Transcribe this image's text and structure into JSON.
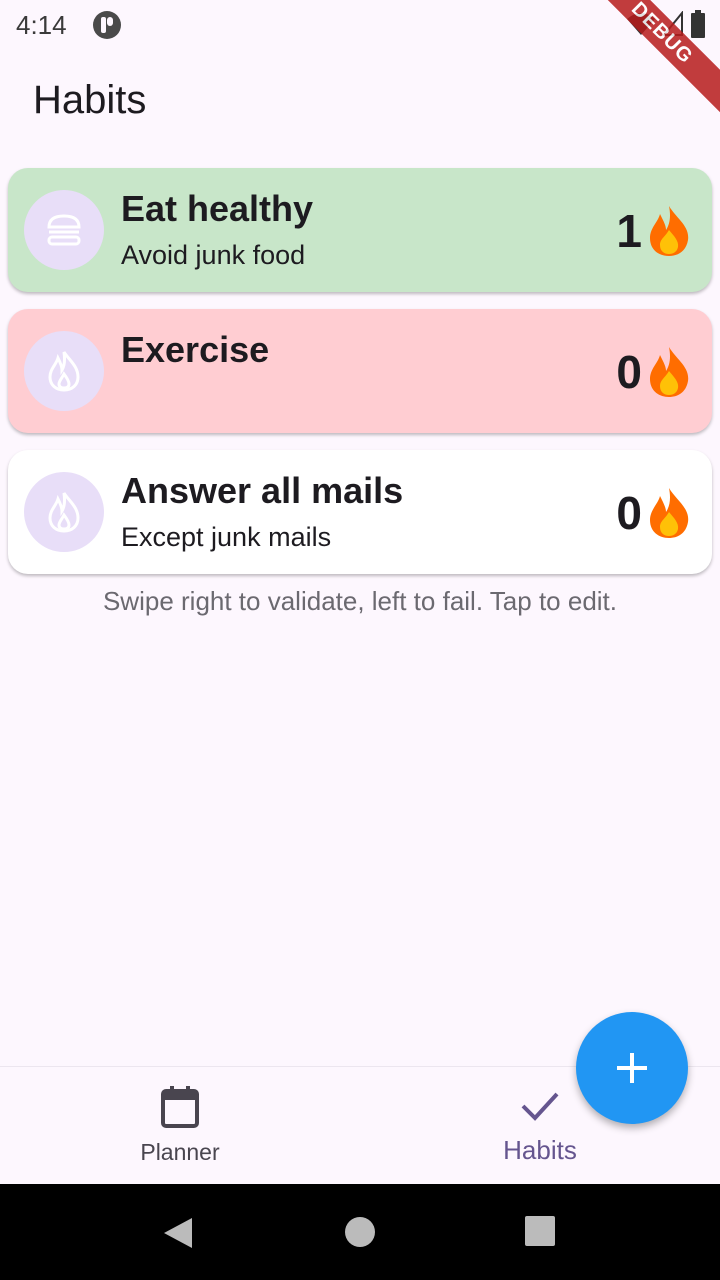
{
  "status_bar": {
    "time": "4:14",
    "debug_label": "DEBUG"
  },
  "page": {
    "title": "Habits",
    "hint": "Swipe right to validate, left to fail. Tap to edit."
  },
  "habits": [
    {
      "title": "Eat healthy",
      "subtitle": "Avoid junk food",
      "streak": "1",
      "icon": "burger-icon",
      "bg_color": "#c8e6c9"
    },
    {
      "title": "Exercise",
      "subtitle": "",
      "streak": "0",
      "icon": "flame-icon",
      "bg_color": "#ffcdd2"
    },
    {
      "title": "Answer all mails",
      "subtitle": "Except junk mails",
      "streak": "0",
      "icon": "flame-icon",
      "bg_color": "#ffffff"
    }
  ],
  "bottom_nav": {
    "items": [
      {
        "label": "Planner",
        "icon": "calendar-icon",
        "selected": false
      },
      {
        "label": "Habits",
        "icon": "check-icon",
        "selected": true
      }
    ]
  },
  "fab": {
    "icon": "plus-icon",
    "color": "#2196f3"
  },
  "colors": {
    "background": "#fdf7fe",
    "accent": "#65558f",
    "icon_circle": "#e8def8"
  }
}
